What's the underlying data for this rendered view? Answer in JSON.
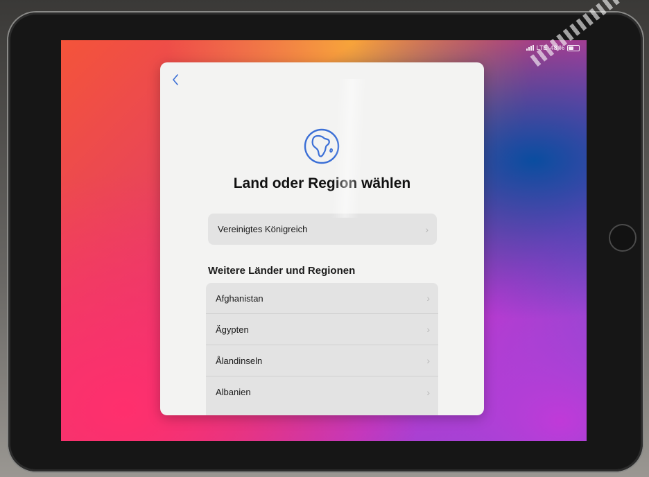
{
  "status_bar": {
    "carrier": "LTE",
    "battery_text": "48 %",
    "battery_level": 0.48
  },
  "setup": {
    "back_icon": "chevron-left-icon",
    "globe_icon": "globe-africa-icon",
    "title": "Land oder Region wählen",
    "selected_country": "Vereinigtes Königreich",
    "section_header": "Weitere Länder und Regionen",
    "countries": [
      "Afghanistan",
      "Ägypten",
      "Ålandinseln",
      "Albanien"
    ],
    "chevron_glyph": "›"
  },
  "colors": {
    "accent": "#3b6fd6",
    "panel_background": "#f3f3f2",
    "row_background": "#e3e3e3"
  }
}
